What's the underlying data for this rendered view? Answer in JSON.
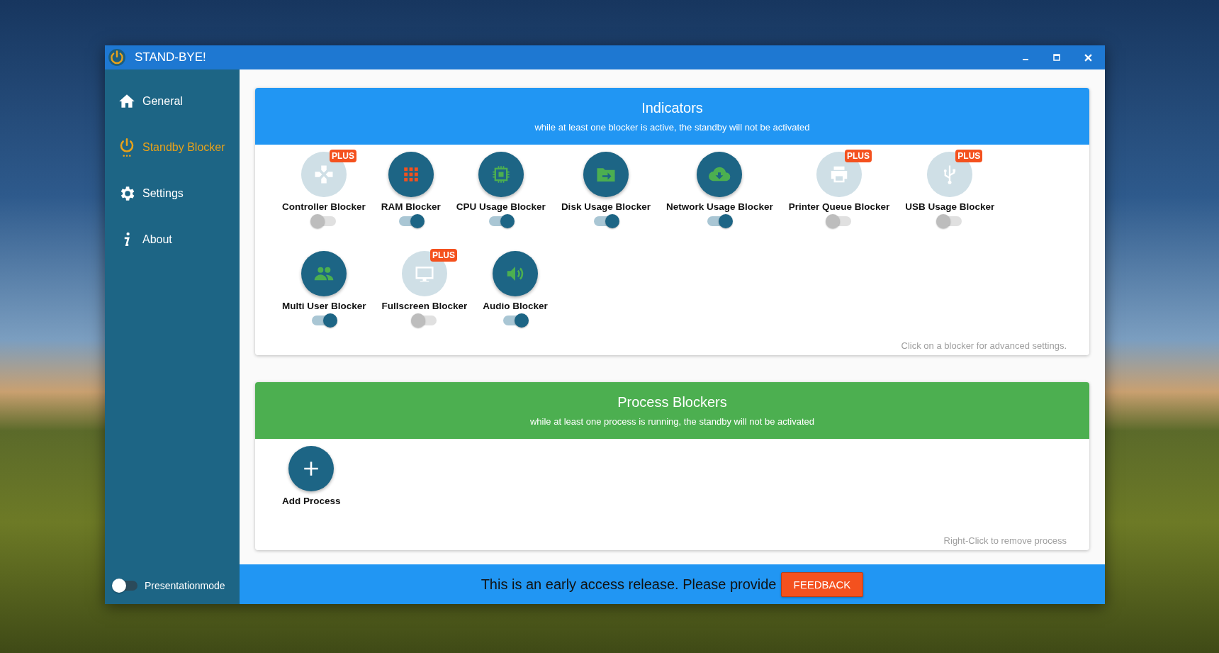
{
  "window": {
    "title": "STAND-BYE!"
  },
  "sidebar": {
    "items": [
      {
        "label": "General",
        "kind": "home",
        "selected": false
      },
      {
        "label": "Standby Blocker",
        "kind": "power",
        "selected": true
      },
      {
        "label": "Settings",
        "kind": "gear",
        "selected": false
      },
      {
        "label": "About",
        "kind": "info",
        "selected": false
      }
    ],
    "presentation_mode": {
      "label": "Presentationmode",
      "on": false
    }
  },
  "indicators": {
    "title": "Indicators",
    "subtitle": "while at least one blocker is active, the standby will not be activated",
    "hint": "Click on a blocker for advanced settings.",
    "blockers": [
      {
        "label": "Controller Blocker",
        "kind": "controller",
        "badge": "PLUS",
        "on": false
      },
      {
        "label": "RAM Blocker",
        "kind": "ram",
        "on": true
      },
      {
        "label": "CPU Usage Blocker",
        "kind": "cpu",
        "on": true
      },
      {
        "label": "Disk Usage Blocker",
        "kind": "disk",
        "on": true
      },
      {
        "label": "Network Usage Blocker",
        "kind": "network",
        "on": true
      },
      {
        "label": "Printer Queue Blocker",
        "kind": "printer",
        "badge": "PLUS",
        "on": false
      },
      {
        "label": "USB Usage Blocker",
        "kind": "usb",
        "badge": "PLUS",
        "on": false
      },
      {
        "label": "Multi User Blocker",
        "kind": "users",
        "on": true
      },
      {
        "label": "Fullscreen Blocker",
        "kind": "monitor",
        "badge": "PLUS",
        "on": false
      },
      {
        "label": "Audio Blocker",
        "kind": "audio",
        "on": true
      }
    ]
  },
  "process_blockers": {
    "title": "Process Blockers",
    "subtitle": "while at least one process is running, the standby will not be activated",
    "add_label": "Add Process",
    "hint": "Right-Click to remove process"
  },
  "footer": {
    "text": "This is an early access release. Please provide",
    "button": "FEEDBACK"
  }
}
